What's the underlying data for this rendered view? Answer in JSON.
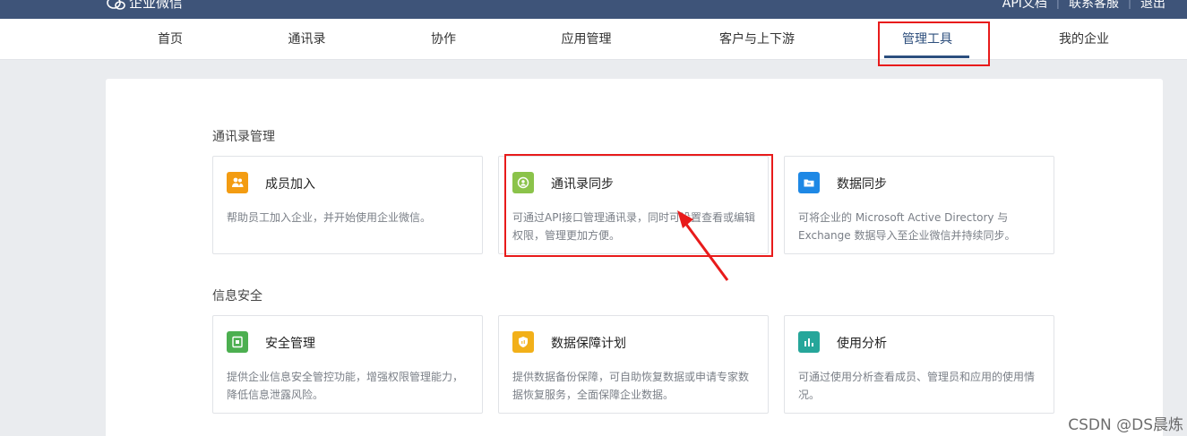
{
  "topbar": {
    "logo_text": "企业微信",
    "links": [
      "API文档",
      "联系客服",
      "退出"
    ],
    "bg": "#3e5479"
  },
  "nav": {
    "items": [
      "首页",
      "通讯录",
      "协作",
      "应用管理",
      "客户与上下游",
      "管理工具",
      "我的企业"
    ],
    "active": "管理工具",
    "accent": "#2c4f7f"
  },
  "sections": [
    {
      "title": "通讯录管理",
      "cards": [
        {
          "title": "成员加入",
          "desc": "帮助员工加入企业，并开始使用企业微信。",
          "icon": "members-icon",
          "color": "#f39c12"
        },
        {
          "title": "通讯录同步",
          "desc": "可通过API接口管理通讯录，同时可设置查看或编辑权限，管理更加方便。",
          "icon": "sync-icon",
          "color": "#8bc34a"
        },
        {
          "title": "数据同步",
          "desc": "可将企业的 Microsoft Active Directory 与 Exchange 数据导入至企业微信并持续同步。",
          "icon": "folder-icon",
          "color": "#1e88e5"
        }
      ]
    },
    {
      "title": "信息安全",
      "cards": [
        {
          "title": "安全管理",
          "desc": "提供企业信息安全管控功能，增强权限管理能力，降低信息泄露风险。",
          "icon": "safe-icon",
          "color": "#4caf50"
        },
        {
          "title": "数据保障计划",
          "desc": "提供数据备份保障，可自助恢复数据或申请专家数据恢复服务，全面保障企业数据。",
          "icon": "shield-icon",
          "color": "#f2b019"
        },
        {
          "title": "使用分析",
          "desc": "可通过使用分析查看成员、管理员和应用的使用情况。",
          "icon": "chart-icon",
          "color": "#26a69a"
        }
      ]
    }
  ],
  "annotation": {
    "color": "#e81b1b"
  },
  "watermark": "CSDN @DS晨炼"
}
